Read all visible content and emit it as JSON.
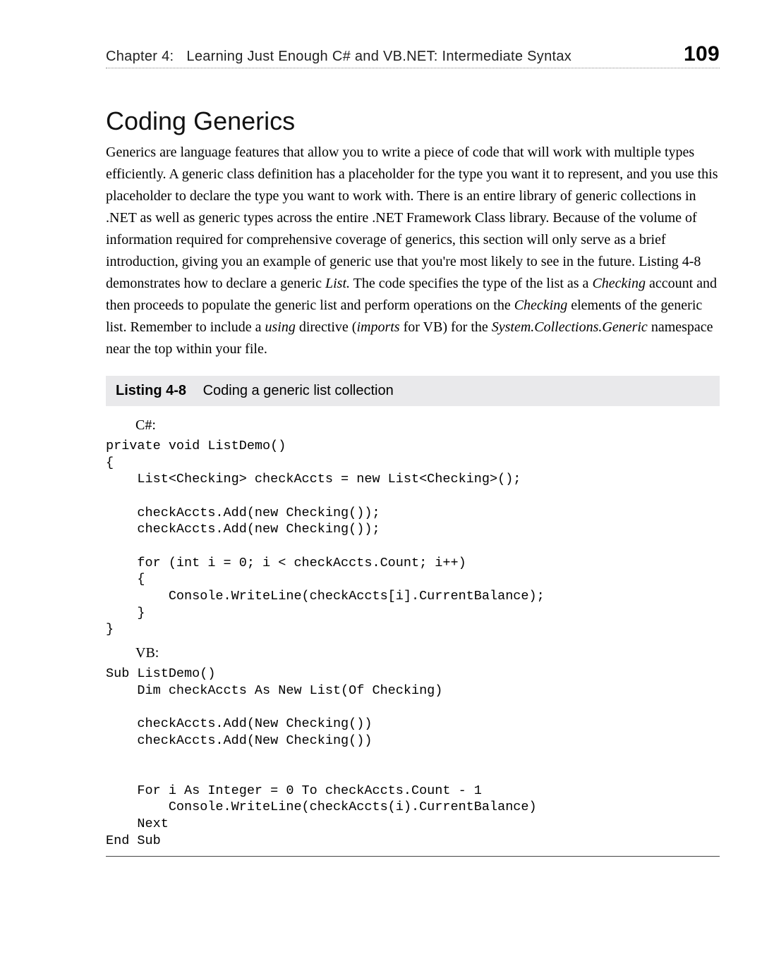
{
  "header": {
    "chapter_label": "Chapter 4:",
    "chapter_title": "Learning Just Enough C# and VB.NET: Intermediate Syntax",
    "page_number": "109"
  },
  "section": {
    "heading": "Coding Generics",
    "paragraph_html": "Generics are language features that allow you to write a piece of code that will work with multiple types efficiently. A generic class definition has a placeholder for the type you want it to represent, and you use this placeholder to declare the type you want to work with. There is an entire library of generic collections in .NET as well as generic types across the entire .NET Framework Class library. Because of the volume of information required for comprehensive coverage of generics, this section will only serve as a brief introduction, giving you an example of generic use that you're most likely to see in the future. Listing 4-8 demonstrates how to declare a generic <em>List.</em> The code specifies the type of the list as a <em>Checking</em> account and then proceeds to populate the generic list and perform operations on the <em>Checking</em> elements of the generic list. Remember to include a <em>using</em> directive (<em>imports</em> for VB) for the <em>System.Collections.Generic</em> namespace near the top within your file."
  },
  "listing": {
    "label": "Listing 4-8",
    "caption": "Coding a generic list collection",
    "csharp_label": "C#:",
    "csharp_code": "private void ListDemo()\n{\n    List<Checking> checkAccts = new List<Checking>();\n\n    checkAccts.Add(new Checking());\n    checkAccts.Add(new Checking());\n\n    for (int i = 0; i < checkAccts.Count; i++)\n    {\n        Console.WriteLine(checkAccts[i].CurrentBalance);\n    }\n}",
    "vb_label": "VB:",
    "vb_code": "Sub ListDemo()\n    Dim checkAccts As New List(Of Checking)\n\n    checkAccts.Add(New Checking())\n    checkAccts.Add(New Checking())\n\n\n    For i As Integer = 0 To checkAccts.Count - 1\n        Console.WriteLine(checkAccts(i).CurrentBalance)\n    Next\nEnd Sub"
  }
}
